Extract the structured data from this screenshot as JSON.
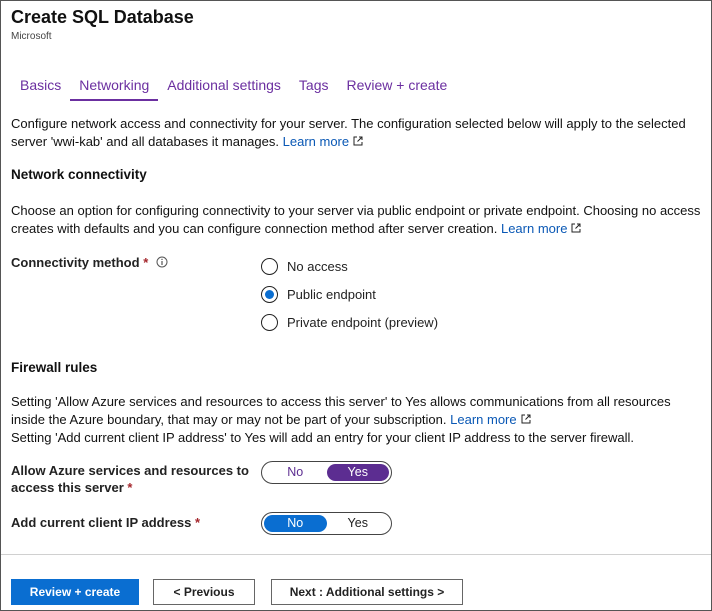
{
  "header": {
    "title": "Create SQL Database",
    "subtitle": "Microsoft"
  },
  "tabs": [
    {
      "label": "Basics",
      "active": false
    },
    {
      "label": "Networking",
      "active": true
    },
    {
      "label": "Additional settings",
      "active": false
    },
    {
      "label": "Tags",
      "active": false
    },
    {
      "label": "Review + create",
      "active": false
    }
  ],
  "intro": {
    "text": "Configure network access and connectivity for your server. The configuration selected below will apply to the selected server 'wwi-kab' and all databases it manages.",
    "link": "Learn more"
  },
  "network_connectivity": {
    "title": "Network connectivity",
    "description": "Choose an option for configuring connectivity to your server via public endpoint or private endpoint. Choosing no access creates with defaults and you can configure connection method after server creation.",
    "link": "Learn more",
    "connectivity_method": {
      "label": "Connectivity method",
      "required_mark": "*",
      "options": [
        {
          "label": "No access",
          "selected": false
        },
        {
          "label": "Public endpoint",
          "selected": true
        },
        {
          "label": "Private endpoint (preview)",
          "selected": false
        }
      ]
    }
  },
  "firewall_rules": {
    "title": "Firewall rules",
    "description_1": "Setting 'Allow Azure services and resources to access this server' to Yes allows communications from all resources inside the Azure boundary, that may or may not be part of your subscription.",
    "link": "Learn more",
    "description_2": "Setting 'Add current client IP address' to Yes will add an entry for your client IP address to the server firewall.",
    "allow_azure": {
      "label": "Allow Azure services and resources to access this server",
      "required_mark": "*",
      "off_label": "No",
      "on_label": "Yes",
      "value": "Yes"
    },
    "add_client_ip": {
      "label": "Add current client IP address",
      "required_mark": "*",
      "off_label": "No",
      "on_label": "Yes",
      "value": "No"
    }
  },
  "footer": {
    "review_create": "Review + create",
    "previous": "< Previous",
    "next": "Next : Additional settings >"
  },
  "colors": {
    "accent_purple": "#5c2d91",
    "tab_purple": "#6b2fa0",
    "primary_blue": "#0a6ed1",
    "link_blue": "#0a58b5",
    "required_red": "#a4262c"
  }
}
